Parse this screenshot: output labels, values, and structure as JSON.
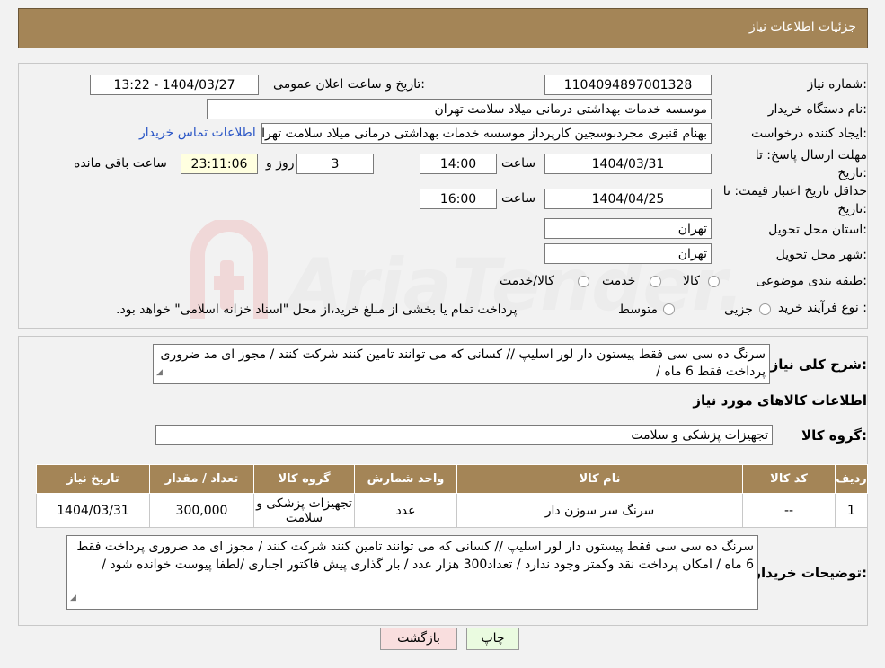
{
  "header": {
    "title": "جزئیات اطلاعات نیاز"
  },
  "form": {
    "need_number_label": "شماره نیاز:",
    "need_number": "1104094897001328",
    "announce_label": "تاریخ و ساعت اعلان عمومی:",
    "announce_value": "1404/03/27 - 13:22",
    "buyer_org_label": "نام دستگاه خریدار:",
    "buyer_org": "موسسه خدمات بهداشتی درمانی میلاد سلامت تهران",
    "creator_label": "ایجاد کننده درخواست:",
    "creator": "بهنام قنبری مجردبوسجین کارپرداز موسسه خدمات بهداشتی درمانی میلاد سلامت تهران",
    "contact_link": "اطلاعات تماس خریدار",
    "deadline_label_1": "مهلت ارسال پاسخ: تا",
    "deadline_label_2": "تاریخ:",
    "deadline_date": "1404/03/31",
    "time_label": "ساعت",
    "deadline_time": "14:00",
    "days_value": "3",
    "days_label": "روز و",
    "remaining_value": "23:11:06",
    "remaining_label": "ساعت باقی مانده",
    "validity_label_1": "حداقل تاریخ اعتبار قیمت: تا",
    "validity_label_2": "تاریخ:",
    "validity_date": "1404/04/25",
    "validity_time_label": "ساعت",
    "validity_time": "16:00",
    "province_label": "استان محل تحویل:",
    "province": "تهران",
    "city_label": "شهر محل تحویل:",
    "city": "تهران",
    "category_label": "طبقه بندی موضوعی:",
    "category_options": [
      "کالا",
      "خدمت",
      "کالا/خدمت"
    ],
    "process_label": "نوع فرآیند خرید :",
    "process_options": [
      "جزیی",
      "متوسط"
    ],
    "process_note": "پرداخت تمام یا بخشی از مبلغ خرید،از محل \"اسناد خزانه اسلامی\" خواهد بود."
  },
  "summary": {
    "label": "شرح کلی نیاز:",
    "text": "سرنگ ده  سی سی  فقط پیستون دار   لور اسلیپ // کسانی که می توانند تامین کنند شرکت کنند / مجوز ای مد ضروری پرداخت فقط 6 ماه  /"
  },
  "goods_info_title": "اطلاعات کالاهای مورد نیاز",
  "goods_group": {
    "label": "گروه کالا:",
    "value": "تجهیزات پزشکی و سلامت"
  },
  "table": {
    "headers": [
      "ردیف",
      "کد کالا",
      "نام کالا",
      "واحد شمارش",
      "گروه کالا",
      "تعداد / مقدار",
      "تاریخ نیاز"
    ],
    "rows": [
      [
        "1",
        "--",
        "سرنگ سر سوزن دار",
        "عدد",
        "تجهیزات پزشکی و سلامت",
        "300,000",
        "1404/03/31"
      ]
    ]
  },
  "buyer_notes": {
    "label": "توضیحات خریدار:",
    "text": "سرنگ ده  سی سی  فقط پیستون دار   لور اسلیپ // کسانی که می توانند تامین کنند شرکت کنند / مجوز ای مد ضروری پرداخت فقط 6 ماه  /  امکان پرداخت نقد وکمتر وجود ندارد / تعداد300 هزار عدد / بار گذاری پیش فاکتور اجباری /لطفا پیوست خوانده شود /"
  },
  "buttons": {
    "print": "چاپ",
    "back": "بازگشت"
  },
  "colors": {
    "header_bg": "#a48557",
    "link": "#2a56c6",
    "back_btn": "#f9dede",
    "print_btn": "#eafbe0"
  }
}
